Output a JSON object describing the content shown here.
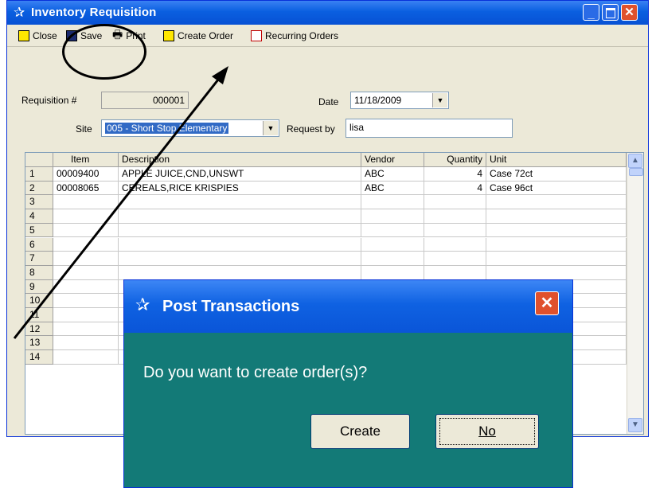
{
  "window": {
    "title": "Inventory Requisition"
  },
  "toolbar": {
    "close_label": "Close",
    "save_label": "Save",
    "print_label": "Print",
    "create_order_label": "Create Order",
    "recurring_orders_label": "Recurring Orders"
  },
  "form": {
    "requisition_label": "Requisition #",
    "requisition_value": "000001",
    "date_label": "Date",
    "date_value": "11/18/2009",
    "site_label": "Site",
    "site_value": "005 - Short Stop Elementary",
    "request_by_label": "Request by",
    "request_by_value": "lisa"
  },
  "grid": {
    "columns": [
      "Item",
      "Description",
      "Vendor",
      "Quantity",
      "Unit"
    ],
    "rows": [
      {
        "no": "1",
        "item": "00009400",
        "description": "APPLE JUICE,CND,UNSWT",
        "vendor": "ABC",
        "quantity": "4",
        "unit": "Case 72ct"
      },
      {
        "no": "2",
        "item": "00008065",
        "description": "CEREALS,RICE KRISPIES",
        "vendor": "ABC",
        "quantity": "4",
        "unit": "Case 96ct"
      },
      {
        "no": "3"
      },
      {
        "no": "4"
      },
      {
        "no": "5"
      },
      {
        "no": "6"
      },
      {
        "no": "7"
      },
      {
        "no": "8"
      },
      {
        "no": "9"
      },
      {
        "no": "10"
      },
      {
        "no": "11"
      },
      {
        "no": "12"
      },
      {
        "no": "13"
      },
      {
        "no": "14"
      }
    ]
  },
  "dialog": {
    "title": "Post Transactions",
    "message": "Do you want to create order(s)?",
    "create_label": "Create",
    "no_label": "No"
  },
  "colors": {
    "titlebar": "#0a5fe0",
    "dialog_body": "#137a77",
    "close_button": "#e0512c",
    "selection": "#316ac5"
  }
}
